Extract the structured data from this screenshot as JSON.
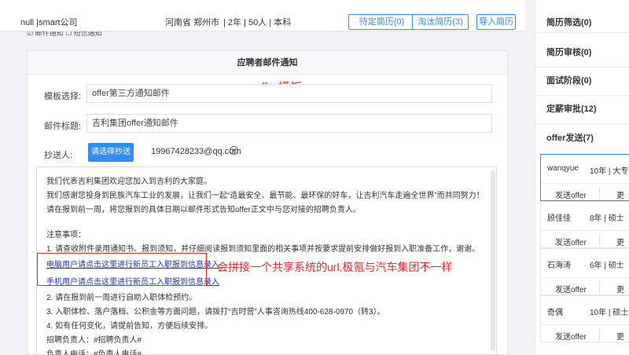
{
  "header": {
    "company": "null |smart公司",
    "location": "河南省  郑州市",
    "meta": "| 2年 | 50人 | 本科",
    "buttons": [
      "待定简历(0)",
      "淘汰简历(3)",
      "导入简历"
    ],
    "subcheck": "☑ 邮件通知  ☐ 短信通知"
  },
  "panel": {
    "title": "应聘者邮件通知",
    "offer_tag": "offer模板",
    "template_label": "模板选择:",
    "template_value": "offer第三方通知邮件",
    "subject_label": "邮件标题:",
    "subject_value": "吉利集团offer通知邮件",
    "cc_label": "抄送人:",
    "cc_button": "请选择抄送人",
    "cc_email": "19967428233@qq.com"
  },
  "editor": {
    "lines": [
      "我们代表吉利集团欢迎您加入到吉利的大家庭。",
      "我们感谢您投身到民族汽车工业的发展，让我们一起“造最安全、最节能、最环保的好车，让吉利汽车走遍全世界”而共同努力！",
      "请在报到前一周，将您报到的具体日期以邮件形式告知offer正文中与您对接的招聘负责人。",
      "",
      "注意事项：",
      "1. 请查收附件录用通知书、报到须知，并仔细阅读报到须知里面的相关事项并按要求提前安排做好报到入职准备工作，谢谢。"
    ],
    "link_pc": "电脑用户请点击这里进行新员工入职报到信息录入",
    "link_mobile": "手机用户请点击这里进行新员工入职报到信息录入",
    "lines_after": [
      "2. 请在报到前一周进行自助入职体检预约。",
      "3. 入职体检、落户落档、公积金等方面问题，请拨打“吉时营”人事咨询热线400-628-0970（转3）。",
      "4. 如有任何变化，请提前告知，方便后续安排。",
      "招聘负责人：#招聘负责人#",
      "负责人电话：#负责人电话#"
    ],
    "annotation": "会拼接一个共享系统的url,极氪与汽车集团不一样"
  },
  "sidebar": {
    "stages": [
      "简历筛选(0)",
      "简历审核(0)",
      "面试阶段(0)",
      "定薪审批(12)",
      "offer发送(7)"
    ],
    "candidates": [
      {
        "name": "wanqyue",
        "meta": "10年 | 大专",
        "send": "发送offer",
        "more": "更"
      },
      {
        "name": "顾佳佳",
        "meta": "8年 | 硕士",
        "send": "发送offer",
        "more": "更"
      },
      {
        "name": "石海涛",
        "meta": "6年 | 硕士",
        "send": "发送offer",
        "more": "更"
      },
      {
        "name": "奇偶",
        "meta": "10年 | 硕士",
        "send": "发送offer",
        "more": "更"
      }
    ]
  }
}
